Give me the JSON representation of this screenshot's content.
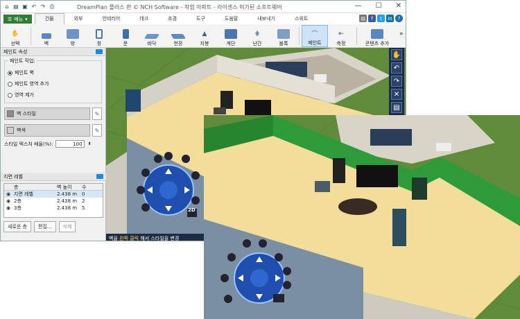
{
  "window": {
    "title": "DreamPlan 플러스 판 © NCH Software - 작업 아파트 - 라이센스 허가된 소프트웨어",
    "controls": [
      "—",
      "☐",
      "✕"
    ]
  },
  "menu": {
    "button_label": "메뉴",
    "tabs": [
      "건물",
      "외부",
      "인테리어",
      "데크",
      "조경",
      "도구",
      "도움말",
      "내보내기",
      "스위트"
    ],
    "active_tab": "건물"
  },
  "toolbar": {
    "tools": [
      {
        "label": "선택",
        "icon": "hand-icon"
      },
      {
        "label": "벽",
        "icon": "wall-icon"
      },
      {
        "label": "방",
        "icon": "room-icon"
      },
      {
        "label": "창",
        "icon": "window-icon"
      },
      {
        "label": "문",
        "icon": "door-icon"
      },
      {
        "label": "바닥",
        "icon": "floor-icon"
      },
      {
        "label": "천장",
        "icon": "ceiling-icon"
      },
      {
        "label": "지붕",
        "icon": "roof-icon"
      },
      {
        "label": "계단",
        "icon": "stairs-icon"
      },
      {
        "label": "난간",
        "icon": "railing-icon"
      },
      {
        "label": "블록",
        "icon": "block-icon"
      },
      {
        "label": "페인트",
        "icon": "paint-icon"
      },
      {
        "label": "측정",
        "icon": "measure-icon"
      },
      {
        "label": "콘텐츠 추가",
        "icon": "add-content-icon"
      }
    ],
    "active_tool": "페인트",
    "more_label": "»"
  },
  "paint_panel": {
    "title": "페인트 속성",
    "group_label": "페인트 작업:",
    "options": [
      "페인트 벽",
      "페인트 영역 추가",
      "영역 제거"
    ],
    "selected_option": "페인트 벽",
    "style_label": "벽 스타일",
    "color_label": "벽색",
    "scale_label": "스타일 텍스처 배율(%):",
    "scale_value": "100"
  },
  "layers_panel": {
    "title": "지면 레벨",
    "columns": [
      "층",
      "벽 높이",
      "수"
    ],
    "rows": [
      {
        "name": "지면 레벨",
        "height": "2.438 m",
        "count": "0"
      },
      {
        "name": "2층",
        "height": "2.438 m",
        "count": "2"
      },
      {
        "name": "3층",
        "height": "2.438 m",
        "count": "5"
      }
    ],
    "buttons": [
      "새로운 층",
      "편집...",
      "삭제"
    ]
  },
  "status": {
    "part1": "벽을 ",
    "highlight": "왼쪽 클릭",
    "part2": " 해서 스타일을 변경"
  },
  "nav": {
    "zoom_2d": "2D"
  },
  "colors": {
    "accent": "#2d7d32",
    "dark_panel": "#1e2b44",
    "wall_green": "#2e9b3a",
    "floor": "#f2dd9a",
    "grass": "#5f8b3a"
  }
}
